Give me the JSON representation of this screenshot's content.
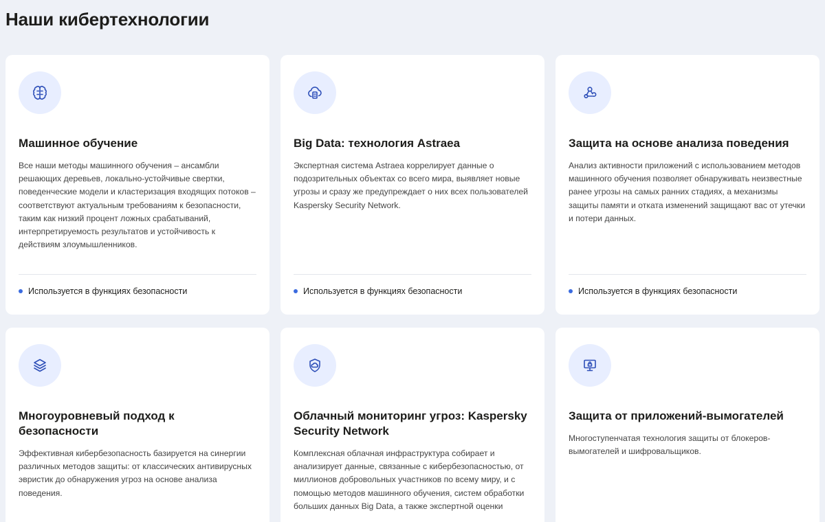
{
  "header": {
    "title": "Наши кибертехнологии"
  },
  "colors": {
    "background": "#eef1f7",
    "card": "#ffffff",
    "icon_badge": "#e8eeff",
    "icon_stroke": "#2e4fb8",
    "dot": "#3b6bdf"
  },
  "cards": [
    {
      "icon": "brain-icon",
      "title": "Машинное обучение",
      "text": "Все наши методы машинного обучения – ансамбли решающих деревьев, локально-устойчивые свертки, поведенческие модели и кластеризация входящих потоков – соответствуют актуальным требованиям к безопасности, таким как низкий процент ложных срабатываний, интерпретируемость результатов и устойчивость к действиям злоумышленников.",
      "footer": "Используется в функциях безопасности"
    },
    {
      "icon": "cloud-database-icon",
      "title": "Big Data: технология Astraea",
      "text": "Экспертная система Astraea коррелирует данные о подозрительных объектах со всего мира, выявляет новые угрозы и сразу же предупреждает о них всех пользователей Kaspersky Security Network.",
      "footer": "Используется в функциях безопасности"
    },
    {
      "icon": "webhook-icon",
      "title": "Защита на основе анализа поведения",
      "text": "Анализ активности приложений с использованием методов машинного обучения позволяет обнаруживать неизвестные ранее угрозы на самых ранних стадиях, а механизмы защиты памяти и отката изменений защищают вас от утечки и потери данных.",
      "footer": "Используется в функциях безопасности"
    },
    {
      "icon": "layers-icon",
      "title": "Многоуровневый подход к безопасности",
      "text": "Эффективная кибербезопасность базируется на синергии различных методов защиты: от классических антивирусных эвристик до обнаружения угроз на основе анализа поведения."
    },
    {
      "icon": "cloud-shield-icon",
      "title": "Облачный мониторинг угроз: Kaspersky Security Network",
      "text": "Комплексная облачная инфраструктура собирает и анализирует данные, связанные с кибербезопасностью, от миллионов добровольных участников по всему миру, и с помощью методов машинного обучения, систем обработки больших данных Big Data, а также экспертной оценки"
    },
    {
      "icon": "monitor-lock-icon",
      "title": "Защита от приложений-вымогателей",
      "text": "Многоступенчатая технология защиты от блокеров-вымогателей и шифровальщиков."
    }
  ]
}
